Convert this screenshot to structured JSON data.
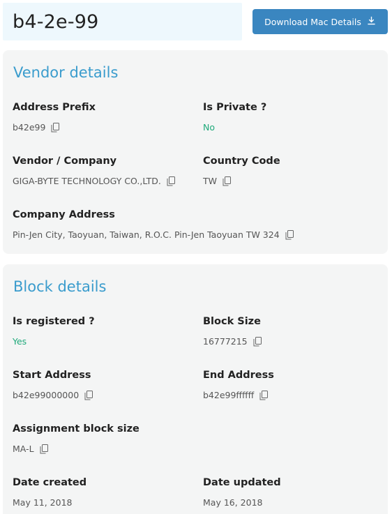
{
  "header": {
    "title": "b4-2e-99",
    "download_label": "Download Mac Details"
  },
  "vendor": {
    "title": "Vendor details",
    "address_prefix": {
      "label": "Address Prefix",
      "value": "b42e99"
    },
    "is_private": {
      "label": "Is Private ?",
      "value": "No"
    },
    "vendor_company": {
      "label": "Vendor / Company",
      "value": "GIGA-BYTE TECHNOLOGY CO.,LTD."
    },
    "country_code": {
      "label": "Country Code",
      "value": "TW"
    },
    "company_address": {
      "label": "Company Address",
      "value": "Pin-Jen City, Taoyuan, Taiwan, R.O.C. Pin-Jen Taoyuan TW 324"
    }
  },
  "block": {
    "title": "Block details",
    "is_registered": {
      "label": "Is registered ?",
      "value": "Yes"
    },
    "block_size": {
      "label": "Block Size",
      "value": "16777215"
    },
    "start_address": {
      "label": "Start Address",
      "value": "b42e99000000"
    },
    "end_address": {
      "label": "End Address",
      "value": "b42e99ffffff"
    },
    "assignment_block_size": {
      "label": "Assignment block size",
      "value": "MA-L"
    },
    "date_created": {
      "label": "Date created",
      "value": "May 11, 2018"
    },
    "date_updated": {
      "label": "Date updated",
      "value": "May 16, 2018"
    }
  },
  "colors": {
    "accent": "#3a9ccd",
    "button": "#3a86c0",
    "positive": "#1fa97a"
  },
  "icons": {
    "copy": "copy-icon",
    "download": "download-icon"
  }
}
